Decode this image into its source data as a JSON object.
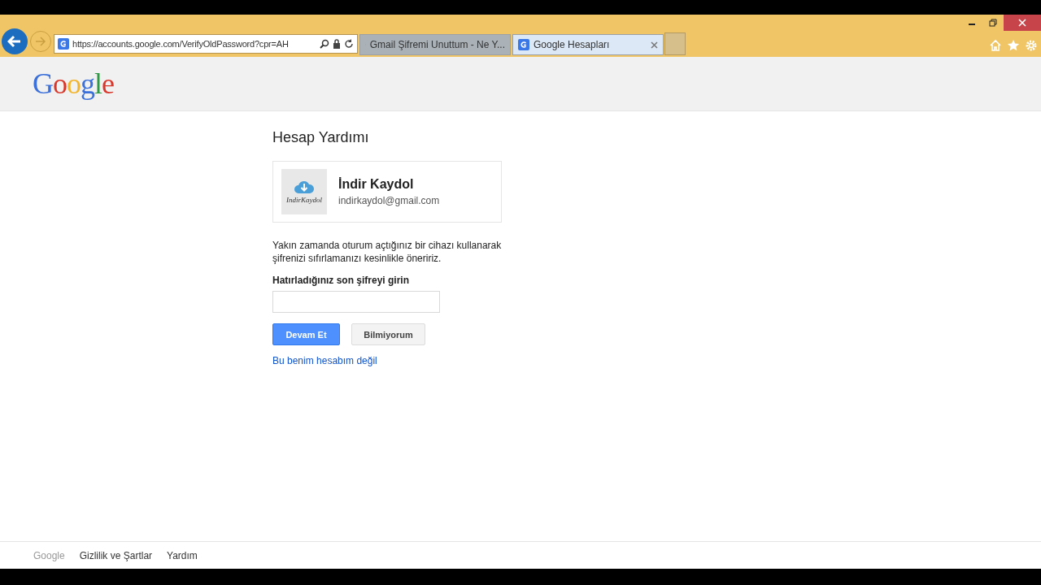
{
  "browser": {
    "address": "https://accounts.google.com/VerifyOldPassword?cpr=AH",
    "tabs": [
      {
        "title": "Gmail Şifremi Unuttum - Ne Y...",
        "selected": false
      },
      {
        "title": "Google Hesapları",
        "selected": true
      }
    ]
  },
  "header": {
    "logo": "Google"
  },
  "page": {
    "title": "Hesap Yardımı",
    "account": {
      "avatar_text": "IndirKaydol",
      "name": "İndir Kaydol",
      "email": "indirkaydol@gmail.com"
    },
    "message": "Yakın zamanda oturum açtığınız bir cihazı kullanarak şifrenizi sıfırlamanızı kesinlikle öneririz.",
    "field_label": "Hatırladığınız son şifreyi girin",
    "buttons": [
      {
        "label": "Devam Et",
        "kind": "primary"
      },
      {
        "label": "Bilmiyorum",
        "kind": "secondary"
      }
    ],
    "link": "Bu benim hesabım değil"
  },
  "footer": [
    "Google",
    "Gizlilik ve Şartlar",
    "Yardım"
  ]
}
